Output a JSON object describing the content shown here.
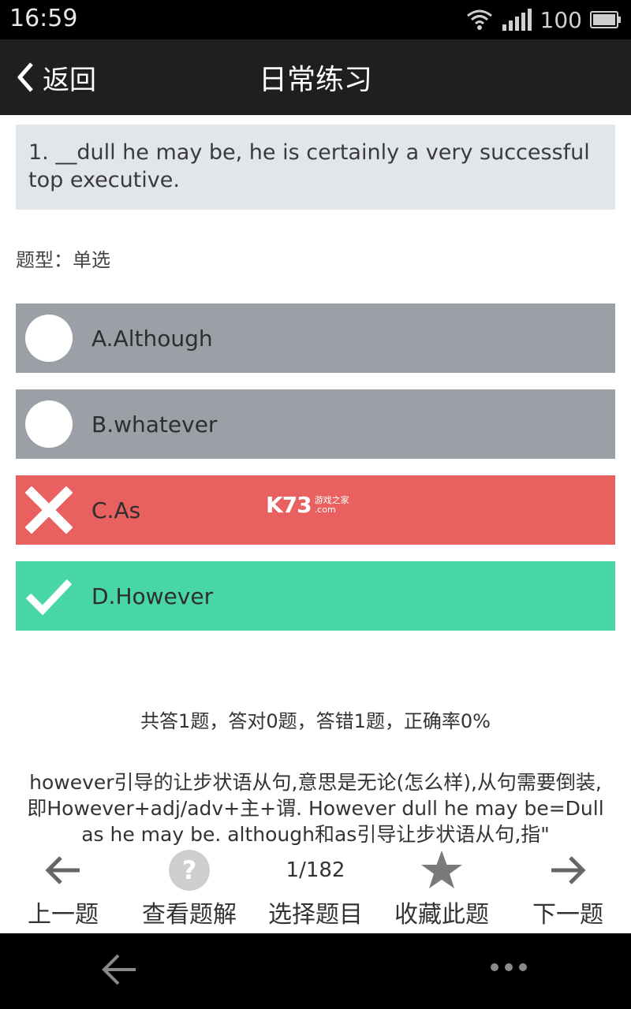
{
  "status_bar": {
    "time": "16:59",
    "battery": "100"
  },
  "nav": {
    "back_label": "返回",
    "title": "日常练习"
  },
  "question": {
    "text": "1. __dull he may be, he is certainly a very successful top executive.",
    "type_label": "题型：单选"
  },
  "options": [
    {
      "label": "A.Although",
      "state": "unselected"
    },
    {
      "label": "B.whatever",
      "state": "unselected"
    },
    {
      "label": "C.As",
      "state": "wrong"
    },
    {
      "label": "D.However",
      "state": "correct"
    }
  ],
  "watermark": {
    "logo": "K73",
    "sub1": "游戏之家",
    "sub2": ".com"
  },
  "stats": "共答1题，答对0题，答错1题，正确率0%",
  "explanation": "however引导的让步状语从句,意思是无论(怎么样),从句需要倒装,即However+adj/adv+主+谓. However dull he may be=Dull as he may be. although和as引导让步状语从句,指\"",
  "toolbar": {
    "prev": "上一题",
    "view_solution": "查看题解",
    "page": "1/182",
    "select": "选择题目",
    "favorite": "收藏此题",
    "next": "下一题"
  },
  "colors": {
    "unselected": "#9aa0a6",
    "wrong": "#e86060",
    "correct": "#47d6a4"
  }
}
